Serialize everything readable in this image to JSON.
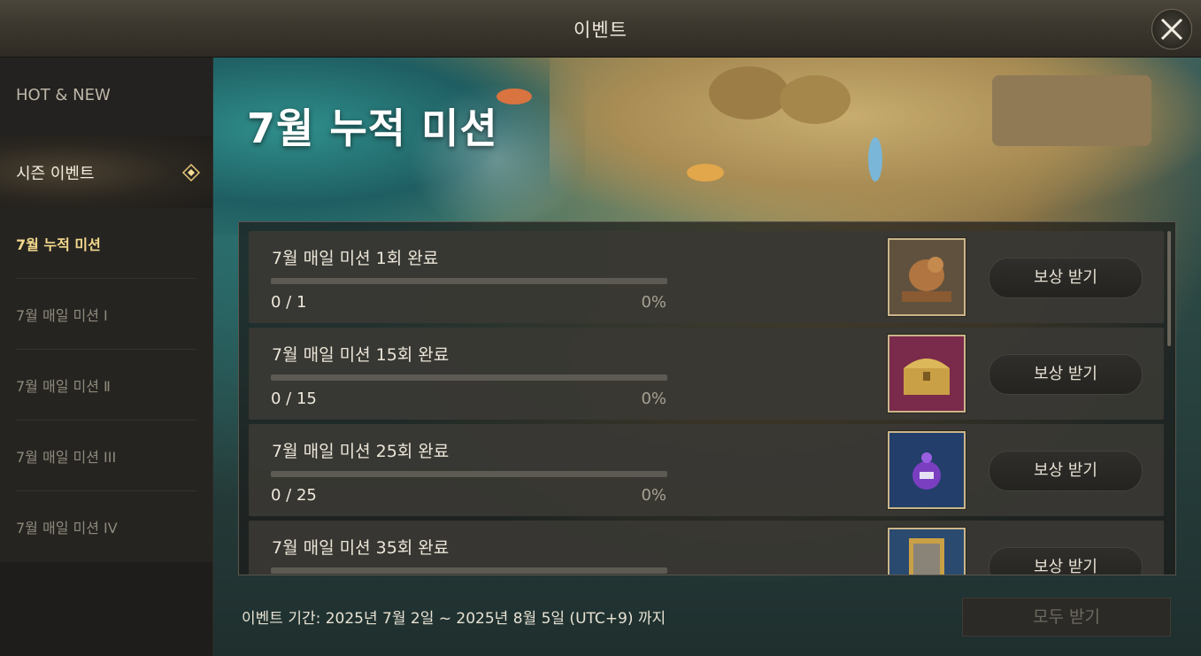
{
  "window": {
    "title": "이벤트"
  },
  "sidebar": {
    "hot_new": "HOT & NEW",
    "season": "시즌 이벤트",
    "items": [
      {
        "label": "7월 누적 미션",
        "active": true
      },
      {
        "label": "7월 매일 미션 Ⅰ",
        "active": false
      },
      {
        "label": "7월 매일 미션 Ⅱ",
        "active": false
      },
      {
        "label": "7월 매일 미션 III",
        "active": false
      },
      {
        "label": "7월 매일 미션 IV",
        "active": false
      }
    ]
  },
  "banner": {
    "title": "7월 누적 미션"
  },
  "missions": [
    {
      "label": "7월 매일 미션 1회 완료",
      "count": "0 / 1",
      "percent": "0%",
      "progress": 0,
      "reward_icon": "dragon-statue-icon",
      "reward_bg": "#6a5a43",
      "button": "보상 받기"
    },
    {
      "label": "7월 매일 미션 15회 완료",
      "count": "0 / 15",
      "percent": "0%",
      "progress": 0,
      "reward_icon": "golden-chest-icon",
      "reward_bg": "#7a2a4a",
      "button": "보상 받기"
    },
    {
      "label": "7월 매일 미션 25회 완료",
      "count": "0 / 25",
      "percent": "0%",
      "progress": 0,
      "reward_icon": "purple-pet-icon",
      "reward_bg": "#233e6a",
      "button": "보상 받기"
    },
    {
      "label": "7월 매일 미션 35회 완료",
      "count": "",
      "percent": "",
      "progress": 0,
      "reward_icon": "card-pack-icon",
      "reward_bg": "#2a4a70",
      "button": "보상 받기"
    }
  ],
  "footer": {
    "period": "이벤트 기간: 2025년 7월 2일 ~ 2025년 8월 5일 (UTC+9) 까지",
    "claim_all": "모두 받기"
  },
  "colors": {
    "accent_gold": "#f3d88c",
    "progress_fill": "#d8b35a"
  }
}
